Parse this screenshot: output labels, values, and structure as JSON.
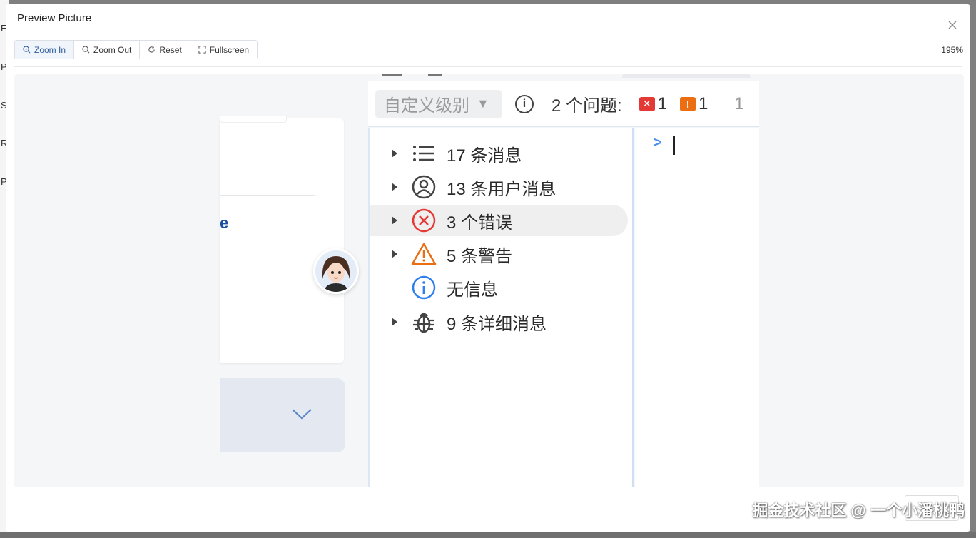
{
  "background": {
    "letters": [
      "E",
      "P",
      "S",
      "R",
      "P"
    ]
  },
  "modal": {
    "title": "Preview Picture",
    "zoom_level": "195%"
  },
  "toolbar": {
    "buttons": [
      {
        "label": "Zoom In",
        "icon": "zoom-in-icon"
      },
      {
        "label": "Zoom Out",
        "icon": "zoom-out-icon"
      },
      {
        "label": "Reset",
        "icon": "reset-icon"
      },
      {
        "label": "Fullscreen",
        "icon": "fullscreen-icon"
      }
    ]
  },
  "preview": {
    "left_fragment": "e",
    "devtools": {
      "level_select": "自定义级别",
      "issues_label": "2 个问题:",
      "error_count": "1",
      "warning_count": "1",
      "trailing_count": "1",
      "sidebar": [
        {
          "label": "17 条消息",
          "icon": "list-icon",
          "expandable": true
        },
        {
          "label": "13 条用户消息",
          "icon": "user-circle-icon",
          "expandable": true
        },
        {
          "label": "3 个错误",
          "icon": "error-circle-icon",
          "expandable": true,
          "selected": true
        },
        {
          "label": "5 条警告",
          "icon": "warning-triangle-icon",
          "expandable": true
        },
        {
          "label": "无信息",
          "icon": "info-circle-icon",
          "expandable": false
        },
        {
          "label": "9 条详细消息",
          "icon": "bug-icon",
          "expandable": true
        }
      ],
      "prompt_symbol": ">"
    }
  },
  "watermark": "掘金技术社区 @ 一个小潘桃鸭",
  "colors": {
    "error": "#e53935",
    "warning": "#ec6e12",
    "info": "#2f80ed",
    "prompt": "#4a8ef0"
  }
}
